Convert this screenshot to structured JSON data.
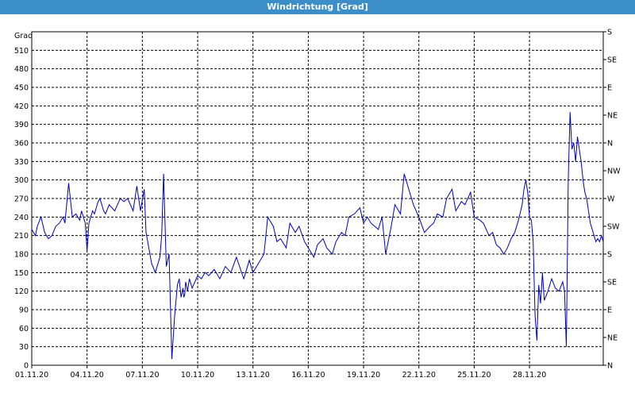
{
  "window": {
    "title": "Windrichtung [Grad]"
  },
  "chart_data": {
    "type": "line",
    "title": "Windrichtung [Grad]",
    "ylabel": "Grad",
    "ylim": [
      0,
      540
    ],
    "yticks": [
      0,
      30,
      60,
      90,
      120,
      150,
      180,
      210,
      240,
      270,
      300,
      330,
      360,
      390,
      420,
      450,
      480,
      510
    ],
    "y2_labels": [
      "N",
      "NE",
      "E",
      "SE",
      "S",
      "SW",
      "W",
      "NW",
      "N",
      "NE",
      "E",
      "SE",
      "S"
    ],
    "x_range": [
      0,
      31
    ],
    "xtick_labels": [
      "01.11.20",
      "04.11.20",
      "07.11.20",
      "10.11.20",
      "13.11.20",
      "16.11.20",
      "19.11.20",
      "22.11.20",
      "25.11.20",
      "28.11.20"
    ],
    "grid": true,
    "colors": {
      "line": "#0000b4",
      "grid": "#000000",
      "axis": "#000000"
    },
    "series": [
      {
        "x": [
          0,
          0.2,
          0.3,
          0.5,
          0.7,
          0.9,
          1.1,
          1.3,
          1.5,
          1.7,
          1.8,
          2.0,
          2.2,
          2.4,
          2.6,
          2.7,
          2.9,
          3.0,
          3.1,
          3.3,
          3.4,
          3.6,
          3.7,
          3.9,
          4.0,
          4.2,
          4.5,
          4.8,
          5.0,
          5.2,
          5.5,
          5.7,
          5.9,
          6.1,
          6.2,
          6.5,
          6.7,
          6.8,
          6.95,
          7.05,
          7.15,
          7.3,
          7.45,
          7.6,
          7.75,
          7.9,
          8.0,
          8.1,
          8.2,
          8.25,
          8.3,
          8.35,
          8.45,
          8.55,
          8.7,
          9.0,
          9.2,
          9.4,
          9.6,
          9.9,
          10.2,
          10.5,
          10.8,
          11.1,
          11.5,
          11.8,
          12.0,
          12.4,
          12.6,
          12.8,
          13.1,
          13.3,
          13.5,
          13.8,
          14.0,
          14.3,
          14.5,
          14.8,
          15.0,
          15.3,
          15.5,
          15.8,
          16.0,
          16.3,
          16.5,
          16.8,
          17.0,
          17.2,
          17.5,
          17.8,
          18.0,
          18.2,
          18.4,
          18.6,
          18.8,
          19.0,
          19.2,
          19.5,
          19.7,
          20.0,
          20.2,
          20.5,
          20.7,
          21.0,
          21.3,
          21.6,
          21.8,
          22.0,
          22.3,
          22.5,
          22.8,
          23.0,
          23.3,
          23.5,
          23.8,
          24.0,
          24.3,
          24.5,
          24.8,
          25.0,
          25.2,
          25.4,
          25.6,
          25.8,
          26.0,
          26.2,
          26.4,
          26.6,
          26.7,
          26.8,
          26.9,
          27.0,
          27.1,
          27.2,
          27.3,
          27.4,
          27.5,
          27.6,
          27.7,
          27.8,
          28.0,
          28.2,
          28.4,
          28.6,
          28.8,
          28.9,
          29.0,
          29.1,
          29.2,
          29.3,
          29.4,
          29.5,
          29.6,
          29.7,
          29.8,
          29.9,
          30.0,
          30.1,
          30.2,
          30.3,
          30.4,
          30.5,
          30.6,
          30.7,
          30.8,
          30.9,
          31.0
        ],
        "y": [
          220,
          210,
          225,
          240,
          215,
          205,
          210,
          225,
          230,
          240,
          230,
          295,
          240,
          245,
          235,
          250,
          230,
          185,
          230,
          250,
          245,
          265,
          270,
          250,
          245,
          260,
          250,
          270,
          265,
          270,
          250,
          290,
          250,
          285,
          215,
          165,
          150,
          160,
          175,
          210,
          310,
          160,
          180,
          10,
          80,
          130,
          140,
          110,
          125,
          110,
          115,
          135,
          120,
          140,
          125,
          145,
          140,
          150,
          145,
          155,
          140,
          160,
          150,
          175,
          140,
          170,
          150,
          170,
          180,
          240,
          225,
          200,
          205,
          190,
          230,
          215,
          225,
          200,
          190,
          175,
          195,
          205,
          190,
          180,
          200,
          215,
          210,
          240,
          245,
          255,
          230,
          240,
          230,
          225,
          220,
          240,
          180,
          225,
          260,
          245,
          310,
          280,
          260,
          240,
          215,
          225,
          230,
          245,
          240,
          270,
          285,
          250,
          265,
          260,
          280,
          240,
          235,
          230,
          210,
          215,
          195,
          190,
          180,
          190,
          205,
          215,
          235,
          260,
          285,
          300,
          280,
          240,
          235,
          200,
          80,
          40,
          130,
          100,
          150,
          105,
          120,
          140,
          125,
          120,
          135,
          120,
          30,
          300,
          410,
          350,
          360,
          330,
          370,
          350,
          330,
          300,
          280,
          270,
          250,
          230,
          220,
          210,
          200,
          205,
          200,
          210,
          200
        ]
      }
    ]
  }
}
